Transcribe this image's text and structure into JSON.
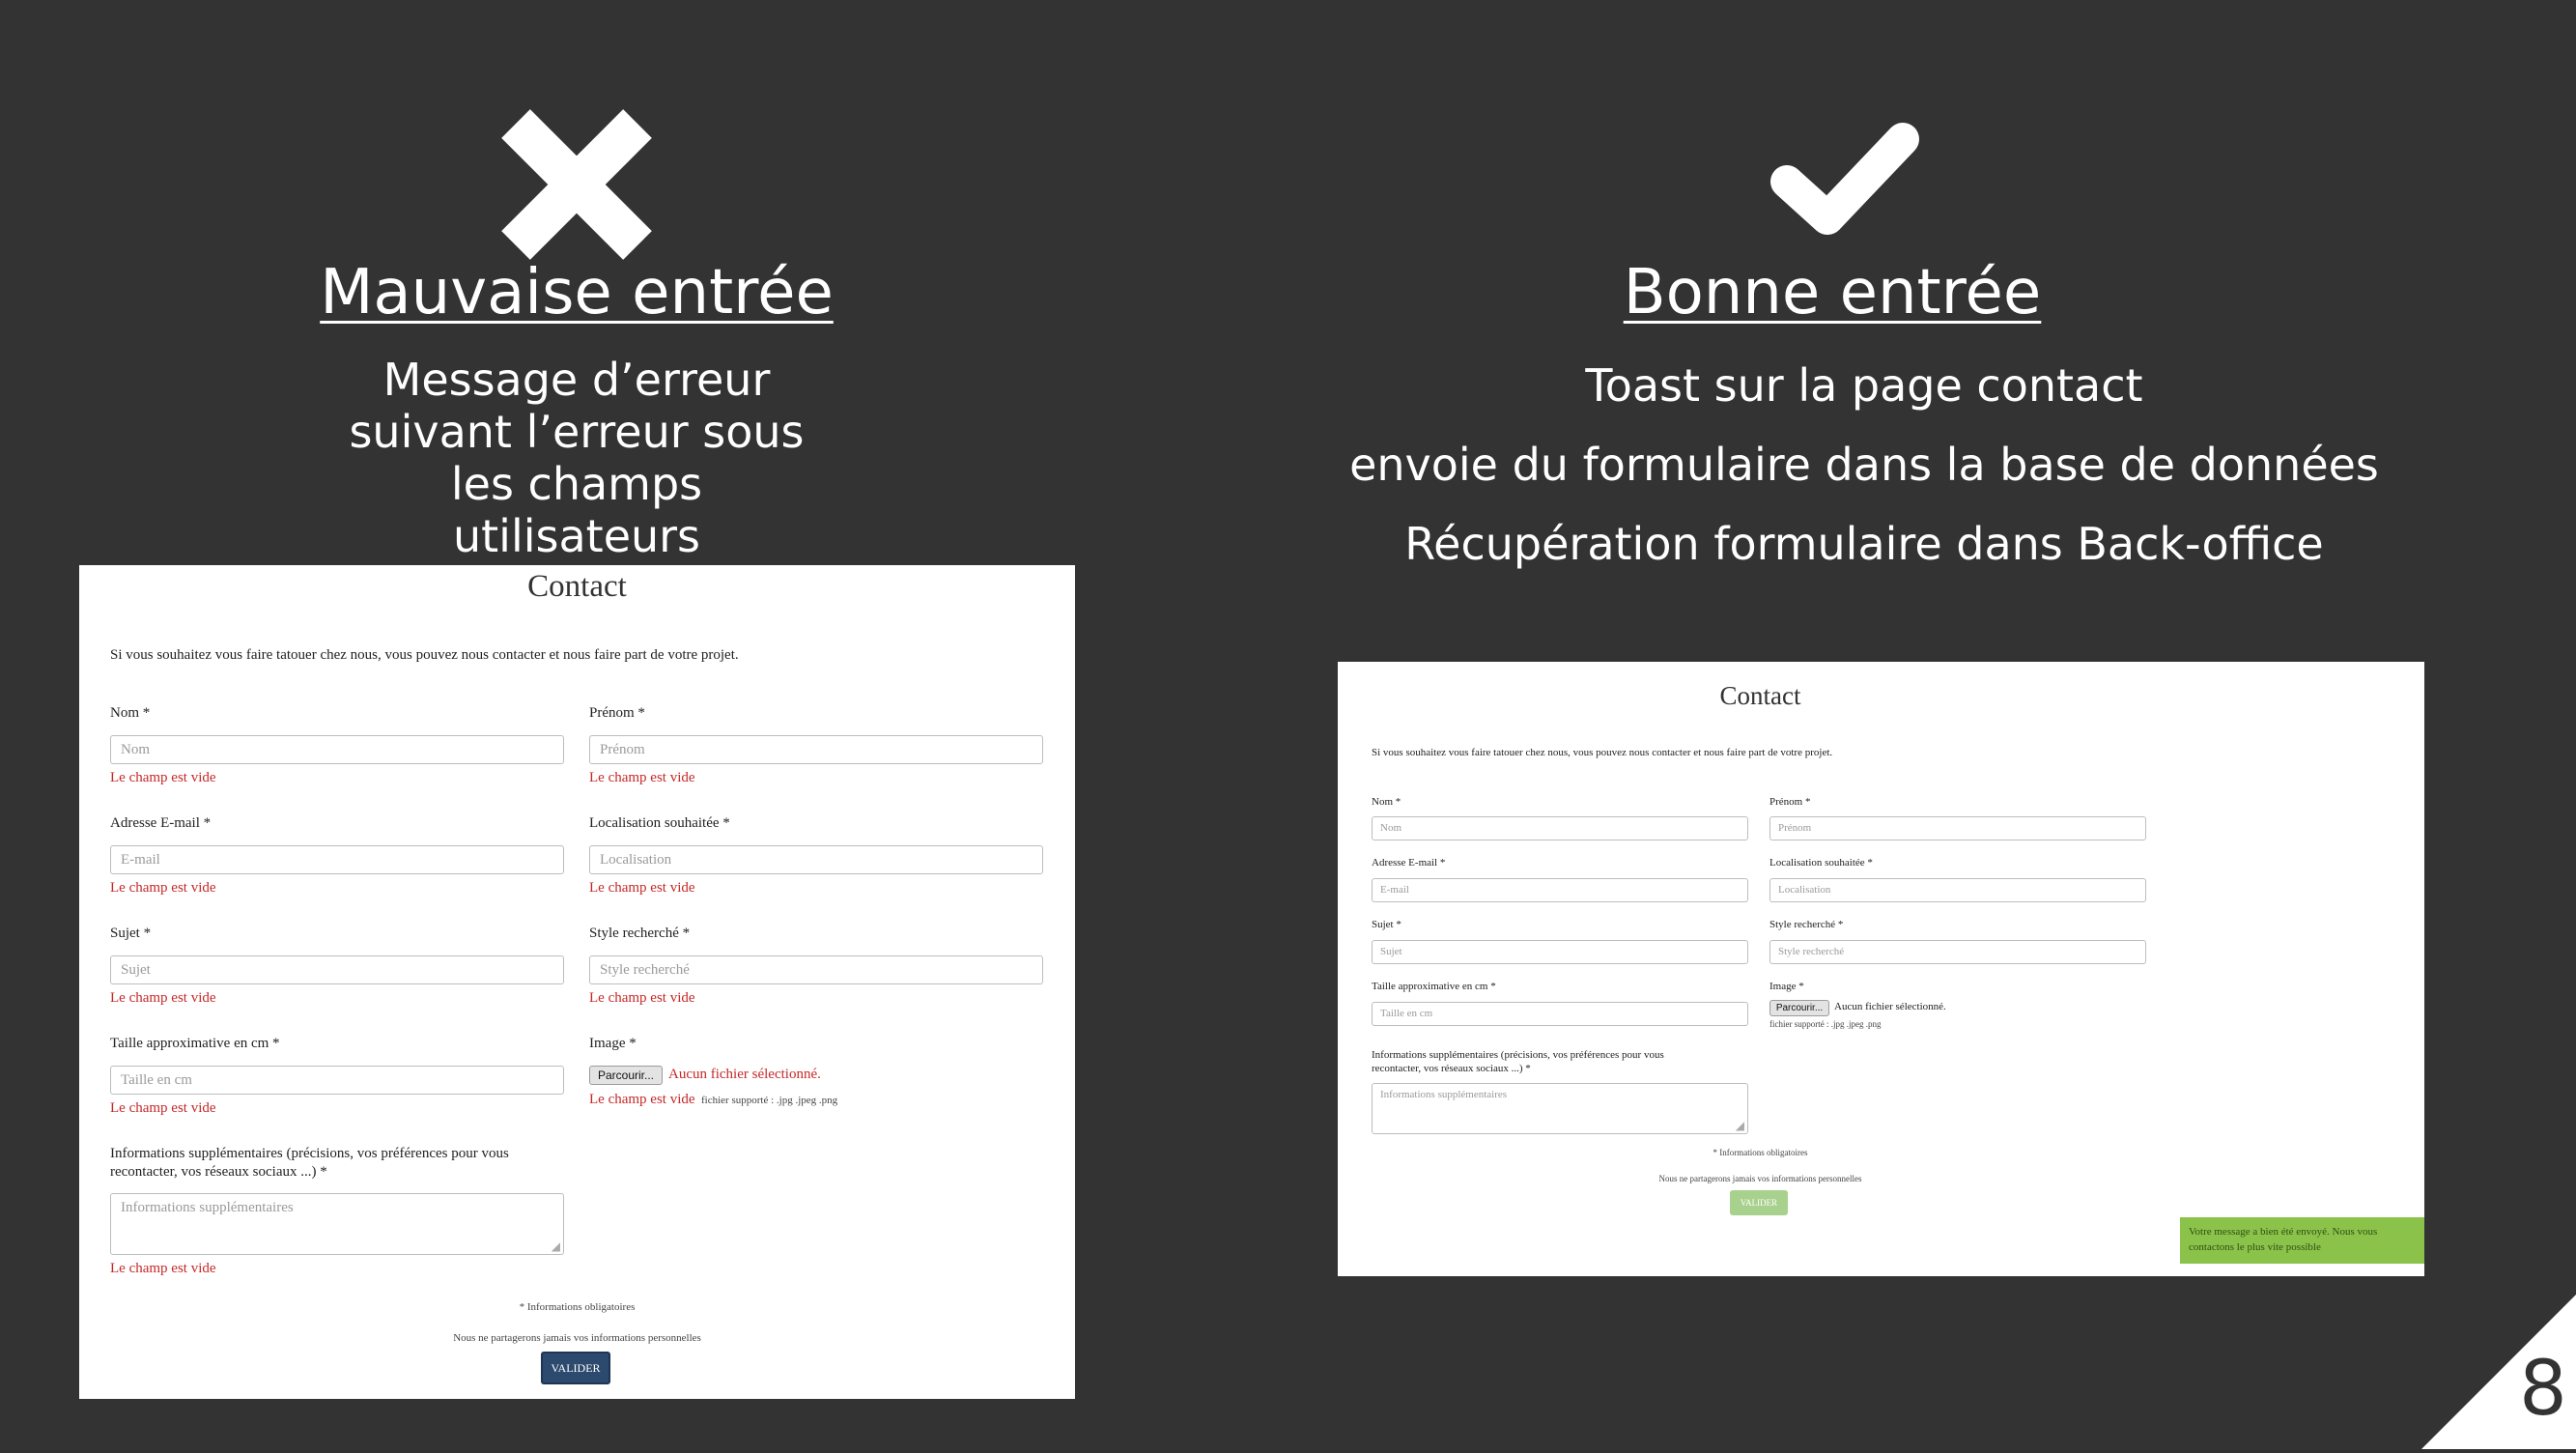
{
  "left": {
    "heading": "Mauvaise entrée",
    "description_lines": [
      "Message d’erreur",
      "suivant l’erreur sous",
      "les champs",
      "utilisateurs"
    ]
  },
  "right": {
    "heading": "Bonne entrée",
    "lines": [
      "Toast sur la page contact",
      "envoie du formulaire dans la base de données",
      "Récupération formulaire dans Back-office"
    ]
  },
  "form": {
    "title": "Contact",
    "intro": "Si vous souhaitez vous faire tatouer chez nous, vous pouvez nous contacter et nous faire part de votre projet.",
    "nom_label": "Nom *",
    "nom_placeholder": "Nom",
    "prenom_label": "Prénom *",
    "prenom_placeholder": "Prénom",
    "email_label": "Adresse E-mail *",
    "email_placeholder": "E-mail",
    "loc_label": "Localisation souhaitée *",
    "loc_placeholder": "Localisation",
    "sujet_label": "Sujet *",
    "sujet_placeholder": "Sujet",
    "style_label": "Style recherché *",
    "style_placeholder": "Style recherché",
    "taille_label": "Taille approximative en cm *",
    "taille_placeholder": "Taille en cm",
    "image_label": "Image *",
    "file_button": "Parcourir...",
    "no_file": "Aucun fichier sélectionné.",
    "file_supported": "fichier supporté : .jpg .jpeg .png",
    "info_label_line1": "Informations supplémentaires (précisions, vos préférences pour vous",
    "info_label_line2": "recontacter, vos réseaux sociaux ...) *",
    "info_placeholder": "Informations supplémentaires",
    "required_note": "* Informations obligatoires",
    "privacy_note": "Nous ne partagerons jamais vos informations personnelles",
    "submit": "VALIDER",
    "error": "Le champ est vide"
  },
  "toast": {
    "line1": "Votre message a bien été envoyé. Nous vous",
    "line2": "contactons le plus vite possible"
  },
  "page_number": "8",
  "colors": {
    "background": "#333333",
    "error": "#c62828",
    "submit_active": "#2c4a6e",
    "submit_disabled": "#a9d18e",
    "toast": "#8bc34a"
  }
}
